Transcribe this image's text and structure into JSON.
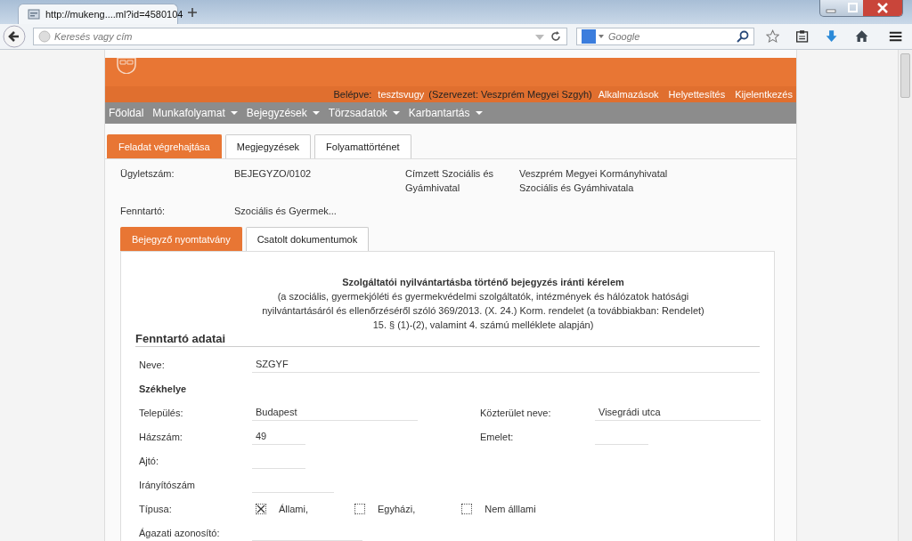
{
  "browser": {
    "tab_title": "http://mukeng....ml?id=4580104",
    "address_placeholder": "Keresés vagy cím",
    "search_placeholder": "Google"
  },
  "header": {
    "login_label": "Belépve:",
    "user": "tesztsvugy",
    "organization": "(Szervezet: Veszprém Megyei Szgyh)",
    "links": [
      "Alkalmazások",
      "Helyettesítés",
      "Kijelentkezés"
    ]
  },
  "menu": [
    {
      "label": "Főoldal",
      "dropdown": false
    },
    {
      "label": "Munkafolyamat",
      "dropdown": true
    },
    {
      "label": "Bejegyzések",
      "dropdown": true
    },
    {
      "label": "Törzsadatok",
      "dropdown": true
    },
    {
      "label": "Karbantartás",
      "dropdown": true
    }
  ],
  "tabs": [
    {
      "label": "Feladat végrehajtása",
      "selected": true
    },
    {
      "label": "Megjegyzések",
      "selected": false
    },
    {
      "label": "Folyamattörténet",
      "selected": false
    }
  ],
  "info": [
    {
      "label": "Ügyletszám:",
      "value": "BEJEGYZO/0102",
      "label_2": "Címzett Szociális és Gyámhivatal",
      "value_2": "Veszprém Megyei Kormányhivatal Szociális és Gyámhivatala"
    },
    {
      "label": "Fenntartó:",
      "value": "Szociális és Gyermek..."
    }
  ],
  "inner_tabs": [
    {
      "label": "Bejegyző nyomtatvány",
      "selected": true
    },
    {
      "label": "Csatolt dokumentumok",
      "selected": false
    }
  ],
  "form": {
    "title": "Szolgáltatói nyilvántartásba történő bejegyzés iránti kérelem",
    "subtitle": "(a szociális, gyermekjóléti és gyermekvédelmi szolgáltatók, intézmények és hálózatok hatósági nyilvántartásáról és ellenőrzéséről szóló 369/2013. (X. 24.) Korm. rendelet (a továbbiakban: Rendelet) 15. § (1)-(2), valamint 4. számú melléklete alapján)",
    "section": "Fenntartó adatai",
    "rows": [
      {
        "kind": "field",
        "label": "Neve:",
        "value": "SZGYF"
      },
      {
        "kind": "heading",
        "label": "Székhelye"
      },
      {
        "kind": "field",
        "label": "Település:",
        "value": "Budapest",
        "label_2": "Közterület neve:",
        "value_2": "Visegrádi utca"
      },
      {
        "kind": "field",
        "label": "Házszám:",
        "value": "49",
        "label_2": "Emelet:"
      },
      {
        "kind": "field",
        "label": "Ajtó:"
      },
      {
        "kind": "field",
        "label": "Irányítószám"
      },
      {
        "kind": "checkboxes",
        "label": "Típusa:",
        "options": [
          {
            "label": "Állami,",
            "checked": true
          },
          {
            "label": "Egyházi,",
            "checked": false
          },
          {
            "label": "Nem álllami",
            "checked": false
          }
        ]
      },
      {
        "kind": "field",
        "label": "Ágazati azonosító:"
      }
    ]
  }
}
